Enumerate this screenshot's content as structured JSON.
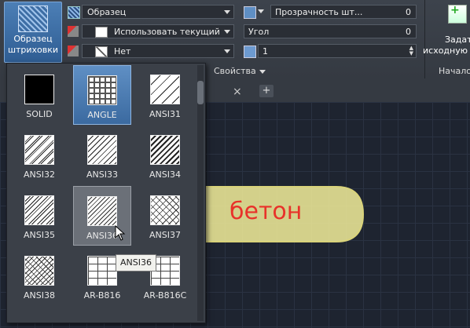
{
  "ribbon": {
    "pattern_button": {
      "line1": "Образец",
      "line2": "штриховки"
    },
    "pattern_combo": "Образец",
    "color_combo": "Использовать текущий",
    "background_combo": "Нет",
    "transparency_label": "Прозрачность шт...",
    "transparency_value": "0",
    "angle_label": "Угол",
    "angle_value": "0",
    "scale_value": "1",
    "properties_label": "Свойства",
    "right_button": {
      "line1": "Задат",
      "line2": "исходную"
    },
    "start_label": "Начало"
  },
  "dropdown": {
    "patterns": [
      {
        "label": "SOLID",
        "type": "solid"
      },
      {
        "label": "ANGLE",
        "type": "angle",
        "selected": true
      },
      {
        "label": "ANSI31",
        "type": "ansi31"
      },
      {
        "label": "ANSI32",
        "type": "ansi32"
      },
      {
        "label": "ANSI33",
        "type": "ansi33"
      },
      {
        "label": "ANSI34",
        "type": "ansi34"
      },
      {
        "label": "ANSI35",
        "type": "ansi35"
      },
      {
        "label": "ANSI36",
        "type": "ansi36",
        "hover": true
      },
      {
        "label": "ANSI37",
        "type": "ansi37"
      },
      {
        "label": "ANSI38",
        "type": "ansi38"
      },
      {
        "label": "AR-B816",
        "type": "brick"
      },
      {
        "label": "AR-B816C",
        "type": "brick"
      }
    ],
    "tooltip": "ANSI36"
  },
  "annotation": {
    "label": "бетон",
    "color": "#e8322a",
    "arrow_color": "#f3ee9a"
  }
}
